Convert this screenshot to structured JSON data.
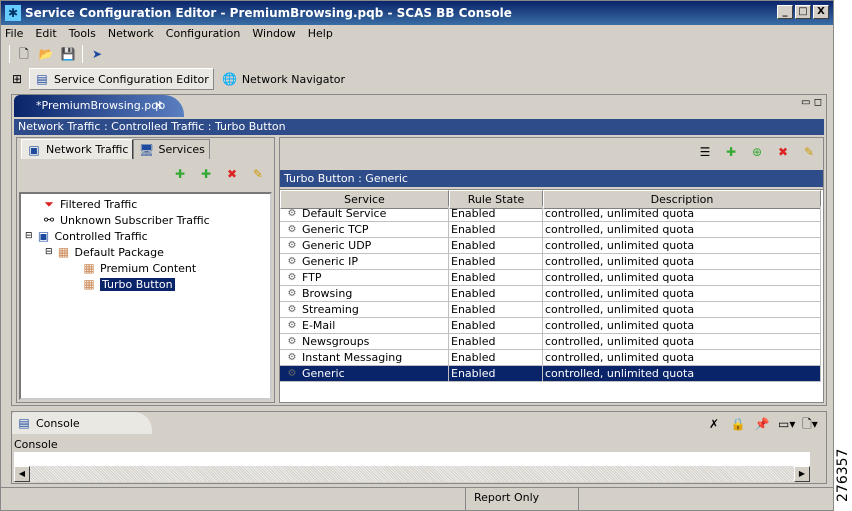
{
  "window": {
    "title": "Service Configuration Editor - PremiumBrowsing.pqb - SCAS BB Console",
    "minimize": "_",
    "maximize": "□",
    "close": "X"
  },
  "menu": [
    "File",
    "Edit",
    "Tools",
    "Network",
    "Configuration",
    "Window",
    "Help"
  ],
  "perspectives": {
    "active": "Service Configuration Editor",
    "other": "Network Navigator"
  },
  "editor": {
    "tab": "*PremiumBrowsing.pqb",
    "close": "✕",
    "breadcrumb": "Network Traffic : Controlled Traffic : Turbo Button"
  },
  "left": {
    "tabs": [
      "Network Traffic",
      "Services"
    ],
    "tree": [
      {
        "label": "Filtered Traffic"
      },
      {
        "label": "Unknown Subscriber Traffic"
      },
      {
        "label": "Controlled Traffic"
      },
      {
        "label": "Default Package"
      },
      {
        "label": "Premium Content"
      },
      {
        "label": "Turbo Button"
      }
    ]
  },
  "right": {
    "header": "Turbo Button : Generic",
    "columns": [
      "Service",
      "Rule State",
      "Description"
    ],
    "rows": [
      [
        "Default Service",
        "Enabled",
        "controlled, unlimited quota"
      ],
      [
        "Generic TCP",
        "Enabled",
        "controlled, unlimited quota"
      ],
      [
        "Generic UDP",
        "Enabled",
        "controlled, unlimited quota"
      ],
      [
        "Generic IP",
        "Enabled",
        "controlled, unlimited quota"
      ],
      [
        "FTP",
        "Enabled",
        "controlled, unlimited quota"
      ],
      [
        "Browsing",
        "Enabled",
        "controlled, unlimited quota"
      ],
      [
        "Streaming",
        "Enabled",
        "controlled, unlimited quota"
      ],
      [
        "E-Mail",
        "Enabled",
        "controlled, unlimited quota"
      ],
      [
        "Newsgroups",
        "Enabled",
        "controlled, unlimited quota"
      ],
      [
        "Instant Messaging",
        "Enabled",
        "controlled, unlimited quota"
      ],
      [
        "Generic",
        "Enabled",
        "controlled, unlimited quota"
      ]
    ]
  },
  "console": {
    "tab": "Console",
    "label": "Console"
  },
  "status": {
    "mode": "Report Only"
  },
  "figure_number": "276357"
}
